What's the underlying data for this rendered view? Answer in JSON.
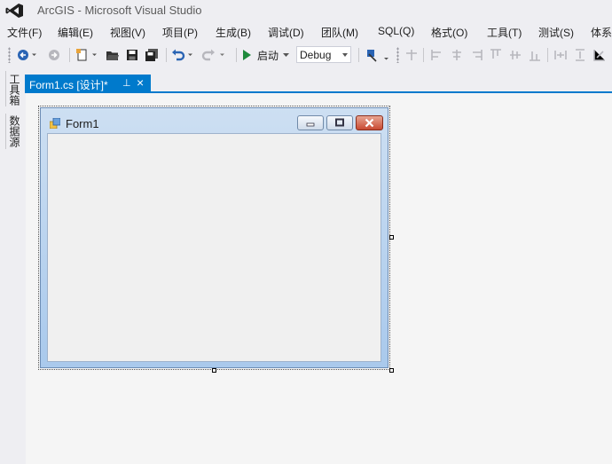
{
  "app": {
    "title": "ArcGIS - Microsoft Visual Studio"
  },
  "menu": {
    "items": [
      "文件(F)",
      "编辑(E)",
      "视图(V)",
      "项目(P)",
      "生成(B)",
      "调试(D)",
      "团队(M)",
      "SQL(Q)",
      "格式(O)",
      "工具(T)",
      "测试(S)",
      "体系"
    ]
  },
  "toolbar": {
    "start_label": "启动",
    "config_value": "Debug"
  },
  "side_tabs": [
    "工具箱",
    "数据源"
  ],
  "editor": {
    "tab_label": "Form1.cs [设计]*",
    "pin_glyph": "⊥",
    "close_glyph": "×"
  },
  "form": {
    "title": "Form1"
  },
  "colors": {
    "accent": "#007acc",
    "start_green": "#1e8a3c",
    "undo_blue": "#2a64b4"
  }
}
